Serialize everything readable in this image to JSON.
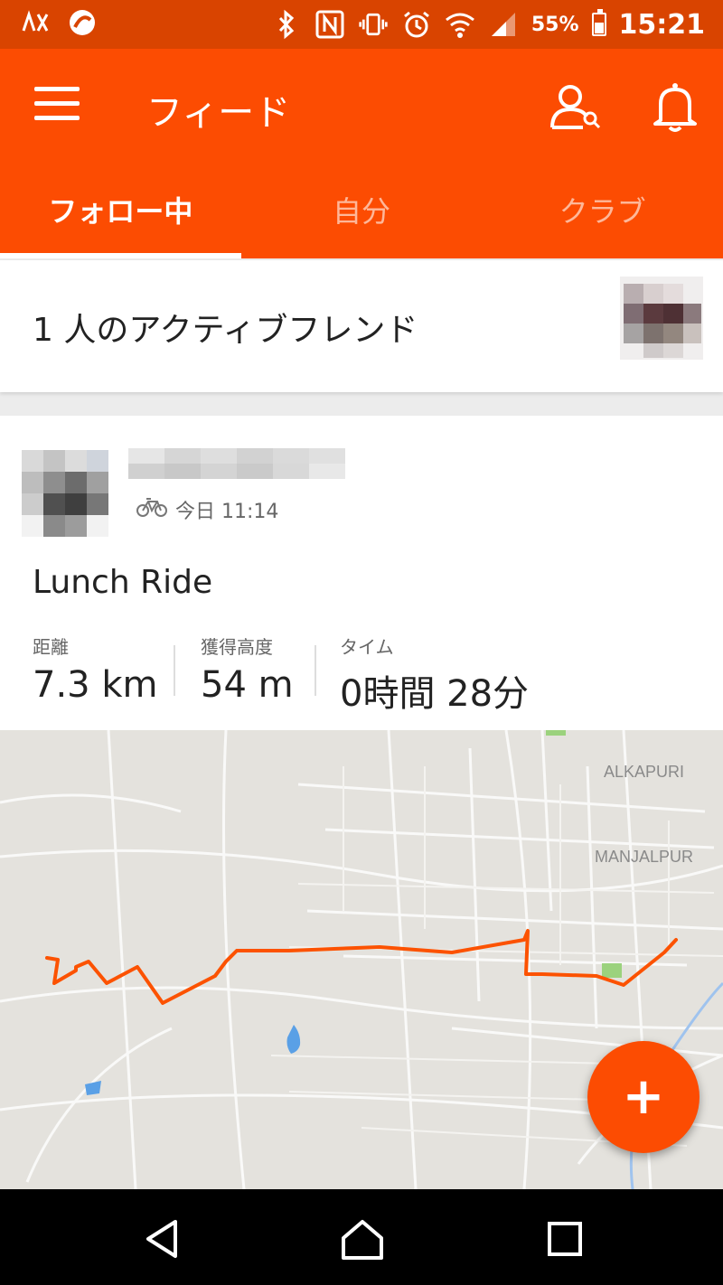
{
  "status_bar": {
    "battery": "55%",
    "time": "15:21",
    "icons": [
      "network-icon",
      "app-notification-icon",
      "bluetooth-icon",
      "nfc-icon",
      "vibrate-icon",
      "alarm-icon",
      "wifi-icon",
      "signal-icon",
      "battery-icon"
    ],
    "battery_level": 0.55
  },
  "app_bar": {
    "title": "フィード",
    "icons": [
      "menu-icon",
      "search-people-icon",
      "bell-icon"
    ]
  },
  "tabs": [
    {
      "label": "フォロー中",
      "active": true
    },
    {
      "label": "自分",
      "active": false
    },
    {
      "label": "クラブ",
      "active": false
    }
  ],
  "friends": {
    "text": "1 人のアクティブフレンド"
  },
  "activity": {
    "meta_icon": "bike-icon",
    "time": "今日 11:14",
    "title": "Lunch Ride",
    "stats": [
      {
        "label": "距離",
        "value": "7.3 km"
      },
      {
        "label": "獲得高度",
        "value": "54 m"
      },
      {
        "label": "タイム",
        "value": "0時間 28分"
      }
    ],
    "map_labels": [
      "ALKAPURI",
      "MANJALPUR"
    ]
  },
  "fab": {
    "label": "+"
  },
  "navigation": {
    "icons": [
      "back-icon",
      "home-icon",
      "recents-icon"
    ]
  },
  "colors": {
    "brand": "#fc4c02",
    "status_bar": "#d94400",
    "route": "#fc5200"
  }
}
